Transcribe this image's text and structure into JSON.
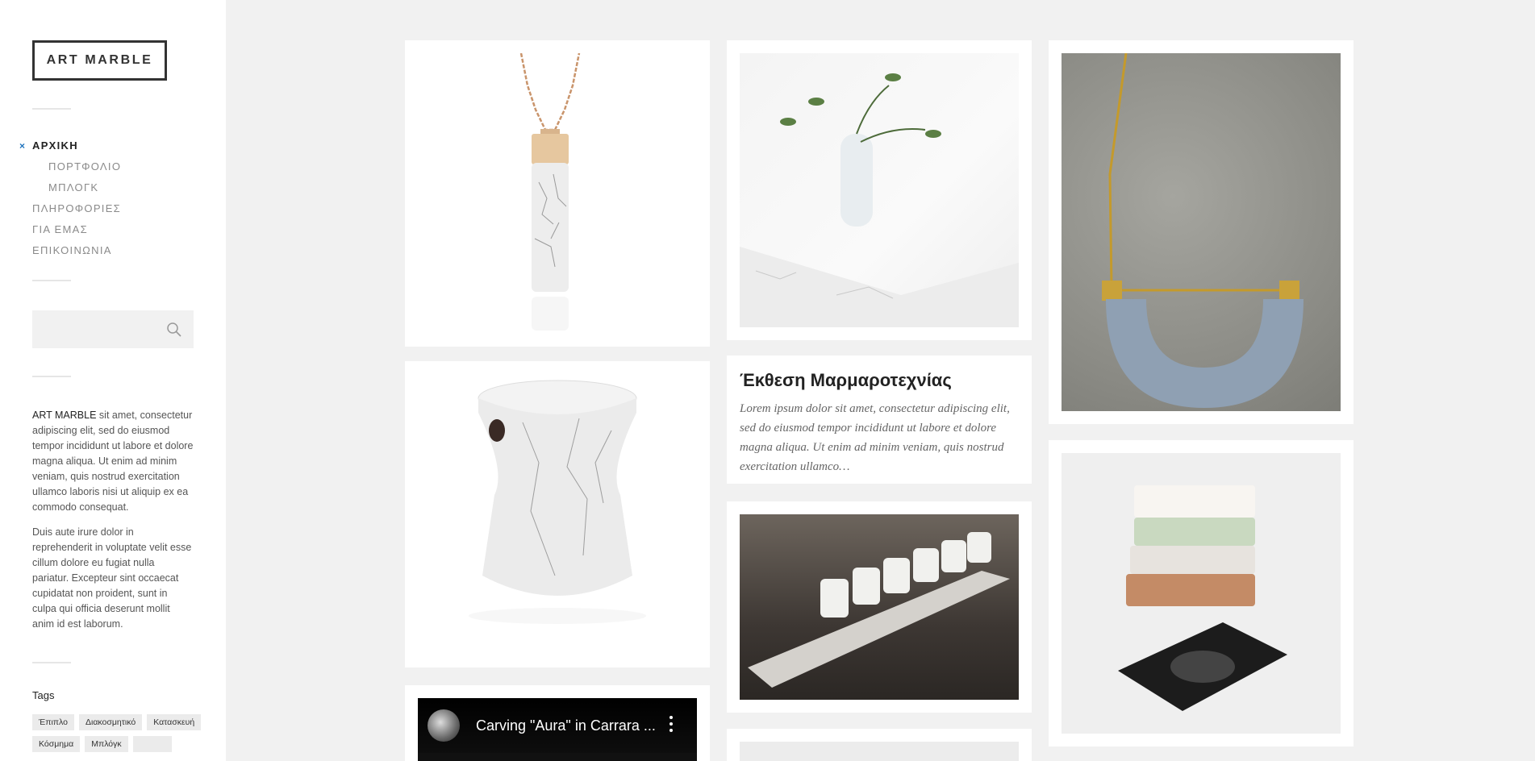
{
  "site": {
    "logo": "ART MARBLE"
  },
  "nav": [
    {
      "label": "ΑΡΧΙΚΗ",
      "active": true
    },
    {
      "label": "ΠΟΡΤΦΟΛΙΟ",
      "sub": true
    },
    {
      "label": "ΜΠΛΟΓΚ",
      "sub": true
    },
    {
      "label": "ΠΛΗΡΟΦΟΡΙΕΣ"
    },
    {
      "label": "ΓΙΑ ΕΜΑΣ"
    },
    {
      "label": "ΕΠΙΚΟΙΝΩΝΙΑ"
    }
  ],
  "nav_active_marker": "×",
  "search": {
    "value": "",
    "placeholder": ""
  },
  "about": {
    "brand": "ART MARBLE",
    "p1_rest": "  sit amet, consectetur adipiscing elit, sed do eiusmod tempor incididunt ut labore et dolore magna aliqua. Ut enim ad minim veniam, quis nostrud exercitation ullamco laboris nisi ut aliquip ex ea commodo consequat.",
    "p2": "Duis aute irure dolor in reprehenderit in voluptate velit esse cillum dolore eu fugiat nulla pariatur. Excepteur sint occaecat cupidatat non proident, sunt in culpa qui officia deserunt mollit anim id est laborum."
  },
  "tags": {
    "title": "Tags",
    "items": [
      "Έπιπλο",
      "Διακοσμητικό",
      "Κατασκευή",
      "Κόσμημα",
      "Μπλόγκ",
      ""
    ]
  },
  "post": {
    "title": "Έκθεση Μαρμαροτεχνίας",
    "excerpt": "Lorem ipsum dolor sit amet, consectetur adipiscing elit, sed do eiusmod tempor incididunt ut labore et dolore magna aliqua. Ut enim ad minim veniam, quis nostrud exercitation ullamco…"
  },
  "video": {
    "title": "Carving \"Aura\" in Carrara ..."
  },
  "icons": {
    "search": "search-icon",
    "menu": "kebab-icon",
    "active": "close-icon"
  },
  "colors": {
    "accent": "#1e73be",
    "background": "#f1f1f1"
  }
}
